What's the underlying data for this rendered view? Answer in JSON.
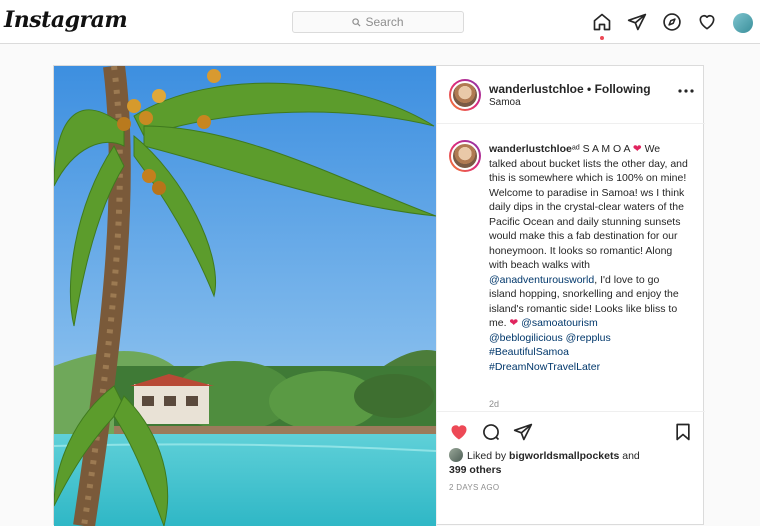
{
  "header": {
    "logo": "Instagram",
    "search_placeholder": "Search"
  },
  "post": {
    "username": "wanderlustchloe",
    "follow_label": "• Following",
    "location": "Samoa",
    "caption": {
      "username": "wanderlustchloe",
      "part1": "ᵃᵈ S A M O A ",
      "part2": " We talked about bucket lists the other day, and this is somewhere which is 100% on mine! Welcome to paradise in Samoa! ws I think daily dips in the crystal-clear waters of the Pacific Ocean and daily stunning sunsets would make this a fab destination for our honeymoon. It looks so romantic! Along with beach walks with ",
      "mention1": "@anadventurousworld",
      "part3": ", I'd love to go island hopping, snorkelling and enjoy the island's romantic side! Looks like bliss to me. ",
      "mention2": "@samoatourism",
      "mention3": "@beblogilicious",
      "mention4": "@repplus",
      "hashtag1": "#BeautifulSamoa",
      "hashtag2": "#DreamNowTravelLater",
      "time": "2d"
    },
    "liked_by_prefix": "Liked by ",
    "liked_by_user": "bigworldsmallpockets",
    "liked_by_suffix": " and",
    "others": "399 others",
    "posted_ago": "2 DAYS AGO"
  },
  "colors": {
    "like_red": "#ed4956",
    "link_blue": "#00376b",
    "border": "#dbdbdb"
  }
}
